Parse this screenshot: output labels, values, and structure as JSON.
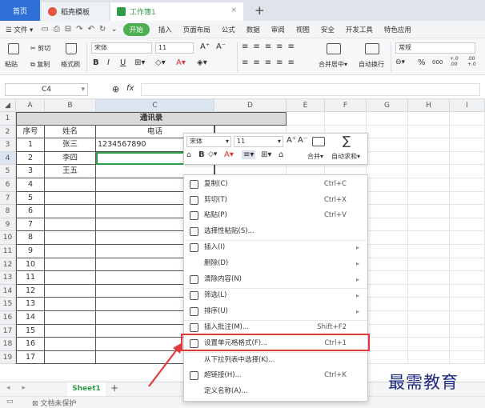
{
  "tabs": {
    "home": "首页",
    "template": "稻壳模板",
    "workbook": "工作簿1",
    "new_tab": "+"
  },
  "menu": {
    "file": "文件",
    "start": "开始",
    "items": [
      "插入",
      "页面布局",
      "公式",
      "数据",
      "审阅",
      "视图",
      "安全",
      "开发工具",
      "特色应用"
    ]
  },
  "ribbon": {
    "paste": "粘贴",
    "cut": "剪切",
    "copy": "复制",
    "format_painter": "格式刷",
    "font_name": "宋体",
    "font_size": "11",
    "font_grow": "A⁺",
    "font_shrink": "A⁻",
    "bold": "B",
    "italic": "I",
    "underline": "U",
    "merge": "合并居中",
    "wrap": "自动换行",
    "number_format": "常规",
    "percent": "%",
    "thousands": "000",
    "inc_dec": "+.0 .00",
    "dec_dec": ".00 +.0"
  },
  "formula_bar": {
    "name_box": "C4",
    "zoom_icon": "magnifier-icon",
    "fx": "fx",
    "value": ""
  },
  "columns": [
    "A",
    "B",
    "C",
    "D",
    "E",
    "F",
    "G",
    "H",
    "I"
  ],
  "rows": [
    "1",
    "2",
    "3",
    "4",
    "5",
    "6",
    "7",
    "8",
    "9",
    "10",
    "11",
    "12",
    "13",
    "14",
    "15",
    "16",
    "17",
    "18",
    "19"
  ],
  "table": {
    "title": "通讯录",
    "headers": [
      "序号",
      "姓名",
      "电话"
    ],
    "records": [
      [
        "1",
        "张三",
        "1234567890"
      ],
      [
        "2",
        "李四",
        ""
      ],
      [
        "3",
        "王五",
        ""
      ],
      [
        "4",
        "",
        ""
      ],
      [
        "5",
        "",
        ""
      ],
      [
        "6",
        "",
        ""
      ],
      [
        "7",
        "",
        ""
      ],
      [
        "8",
        "",
        ""
      ],
      [
        "9",
        "",
        ""
      ],
      [
        "10",
        "",
        ""
      ],
      [
        "11",
        "",
        ""
      ],
      [
        "12",
        "",
        ""
      ],
      [
        "13",
        "",
        ""
      ],
      [
        "14",
        "",
        ""
      ],
      [
        "15",
        "",
        ""
      ],
      [
        "16",
        "",
        ""
      ],
      [
        "17",
        "",
        ""
      ]
    ]
  },
  "sheet": {
    "tab": "Sheet1",
    "add": "+"
  },
  "status": {
    "doc_state": "文档未保护"
  },
  "mini_toolbar": {
    "font": "宋体",
    "size": "11",
    "grow": "A⁺",
    "shrink": "A⁻",
    "bold": "B",
    "merge": "合并",
    "autosum": "自动求和"
  },
  "context_menu": [
    {
      "label": "复制(C)",
      "shortcut": "Ctrl+C",
      "icon": "copy-icon",
      "submenu": false
    },
    {
      "label": "剪切(T)",
      "shortcut": "Ctrl+X",
      "icon": "scissors-icon",
      "submenu": false
    },
    {
      "label": "粘贴(P)",
      "shortcut": "Ctrl+V",
      "icon": "paste-icon",
      "submenu": false
    },
    {
      "label": "选择性粘贴(S)...",
      "shortcut": "",
      "icon": "paste-special-icon",
      "submenu": false
    },
    {
      "label": "插入(I)",
      "shortcut": "",
      "icon": "insert-icon",
      "submenu": true
    },
    {
      "label": "删除(D)",
      "shortcut": "",
      "icon": "",
      "submenu": true
    },
    {
      "label": "清除内容(N)",
      "shortcut": "",
      "icon": "eraser-icon",
      "submenu": true
    },
    {
      "label": "筛选(L)",
      "shortcut": "",
      "icon": "filter-icon",
      "submenu": true
    },
    {
      "label": "排序(U)",
      "shortcut": "",
      "icon": "sort-icon",
      "submenu": true
    },
    {
      "label": "插入批注(M)...",
      "shortcut": "Shift+F2",
      "icon": "comment-icon",
      "submenu": false
    },
    {
      "label": "设置单元格格式(F)...",
      "shortcut": "Ctrl+1",
      "icon": "format-cells-icon",
      "submenu": false
    },
    {
      "label": "从下拉列表中选择(K)...",
      "shortcut": "",
      "icon": "",
      "submenu": false
    },
    {
      "label": "超链接(H)...",
      "shortcut": "Ctrl+K",
      "icon": "link-icon",
      "submenu": false
    },
    {
      "label": "定义名称(A)...",
      "shortcut": "",
      "icon": "",
      "submenu": false
    }
  ],
  "watermark": "最需教育",
  "colors": {
    "accent": "#2f6fd6",
    "start_green": "#4caf50",
    "highlight_red": "#e03b3b",
    "sheet_green": "#2e9b47",
    "watermark": "#1f2a80"
  }
}
